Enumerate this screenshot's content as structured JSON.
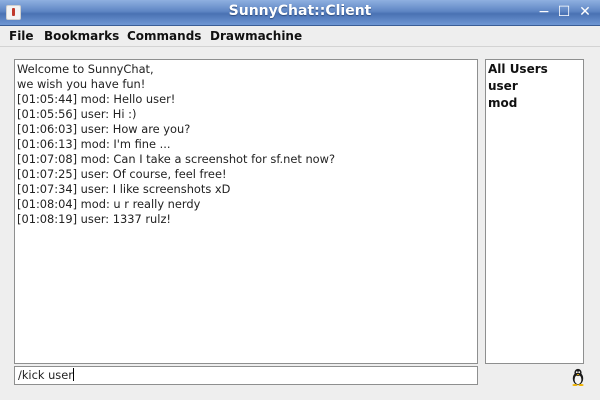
{
  "window": {
    "title": "SunnyChat::Client",
    "minimize_glyph": "−",
    "maximize_glyph": "☐",
    "close_glyph": "✕"
  },
  "menu": [
    {
      "label": "File"
    },
    {
      "label": "Bookmarks"
    },
    {
      "label": "Commands"
    },
    {
      "label": "Drawmachine"
    }
  ],
  "chat": {
    "lines": [
      "Welcome to SunnyChat,",
      "we wish you have fun!",
      "[01:05:44] mod: Hello user!",
      "[01:05:56] user: Hi :)",
      "[01:06:03] user: How are you?",
      "[01:06:13] mod: I'm fine ...",
      "[01:07:08] mod: Can I take a screenshot for sf.net now?",
      "[01:07:25] user: Of course, feel free!",
      "[01:07:34] user: I like screenshots xD",
      "[01:08:04] mod: u r really nerdy",
      "[01:08:19] user: 1337 rulz!"
    ]
  },
  "users": {
    "items": [
      "All Users",
      "user",
      "mod"
    ]
  },
  "input": {
    "value": "/kick user"
  },
  "icons": {
    "status": "tux-penguin-icon"
  },
  "colors": {
    "titlebar": "#5f86c4",
    "window_bg": "#eeeeee"
  }
}
